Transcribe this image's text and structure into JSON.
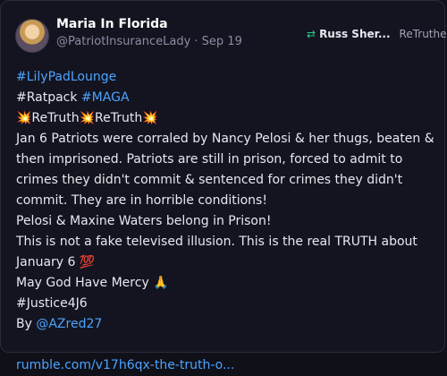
{
  "post": {
    "author_name": "Maria In Florida",
    "author_handle": "@PatriotInsuranceLady",
    "separator": " · ",
    "date": "Sep 19",
    "retruth": {
      "icon": "retruth-icon",
      "user": "Russ Sher...",
      "label": "ReTruthed"
    },
    "lines": {
      "tag_lilypad": "#LilyPadLounge",
      "tag_ratpack": "#Ratpack",
      "tag_maga": "#MAGA",
      "retruth_line": "💥ReTruth💥ReTruth💥",
      "para1": "Jan 6 Patriots were corraled by Nancy Pelosi & her thugs, beaten & then imprisoned. Patriots are still in prison, forced to admit to crimes they didn't commit & sentenced for crimes they didn't commit. They are in horrible conditions!",
      "para2": "Pelosi & Maxine Waters belong in Prison!",
      "para3": "This is not a fake televised illusion. This is the real TRUTH about January 6 💯",
      "para4": "May God Have Mercy 🙏",
      "tag_justice": "#Justice4J6",
      "by_label": "By ",
      "mention": "@AZred27",
      "link": "rumble.com/v17h6qx-the-truth-o..."
    }
  }
}
